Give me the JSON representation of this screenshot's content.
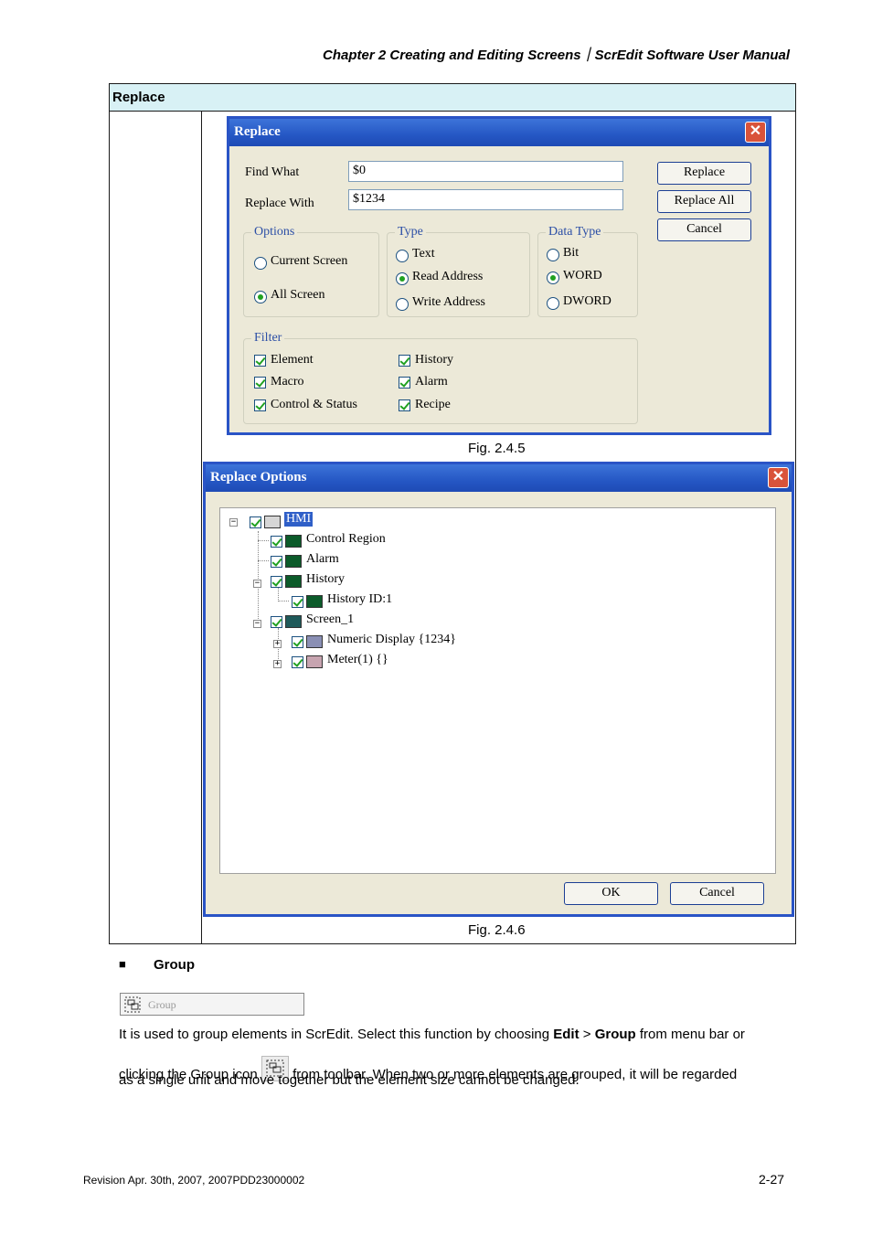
{
  "header": "Chapter 2  Creating and Editing Screens｜ScrEdit Software User Manual",
  "table": {
    "title": "Replace"
  },
  "replace_dialog": {
    "title": "Replace",
    "find_label": "Find What",
    "find_value": "$0",
    "replace_label": "Replace With",
    "replace_value": "$1234",
    "buttons": {
      "replace": "Replace",
      "replace_all": "Replace All",
      "cancel": "Cancel"
    },
    "options": {
      "legend": "Options",
      "current_screen": "Current Screen",
      "all_screen": "All Screen",
      "selected": "All Screen"
    },
    "type": {
      "legend": "Type",
      "text": "Text",
      "read": "Read Address",
      "write": "Write Address",
      "selected": "Read Address"
    },
    "data_type": {
      "legend": "Data Type",
      "bit": "Bit",
      "word": "WORD",
      "dword": "DWORD",
      "selected": "WORD"
    },
    "filter": {
      "legend": "Filter",
      "element": "Element",
      "history": "History",
      "macro": "Macro",
      "alarm": "Alarm",
      "control_status": "Control & Status",
      "recipe": "Recipe"
    }
  },
  "fig1": "Fig. 2.4.5",
  "options_dialog": {
    "title": "Replace Options",
    "tree": {
      "root": "HMI",
      "control_region": "Control Region",
      "alarm": "Alarm",
      "history": "History",
      "history_id": "History ID:1",
      "screen": "Screen_1",
      "numeric": "Numeric Display {1234}",
      "meter": "Meter(1) {}"
    },
    "ok": "OK",
    "cancel": "Cancel"
  },
  "fig2": "Fig. 2.4.6",
  "section": {
    "bullet": "■",
    "title": "Group",
    "toolbar_label": "Group"
  },
  "paragraph": {
    "p1": "It is used to group elements in ScrEdit. Select this function by choosing ",
    "edit": "Edit",
    "gt": " > ",
    "group": "Group",
    "p2": " from menu bar or",
    "p3": "clicking the Group icon ",
    "p4": " from toolbar. When two or more elements are grouped, it will be regarded",
    "p5": "as a single unit and move together but the element size cannot be changed."
  },
  "footer": {
    "revision": "Revision Apr. 30th, 2007, 2007PDD23000002",
    "page": "2-27"
  },
  "colors": {
    "titlebar": "#2557c4",
    "table_header": "#d8f1f5",
    "dialog_bg": "#ece9d8",
    "check": "#21a121"
  }
}
